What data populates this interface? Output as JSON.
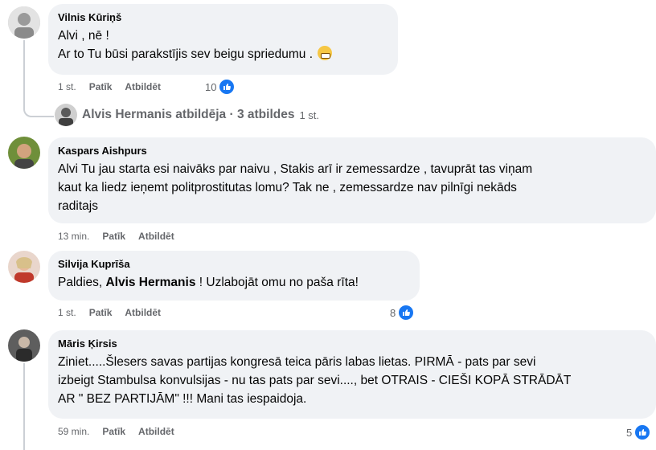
{
  "comments": [
    {
      "author": "Vilnis Kūriņš",
      "lines": [
        "Alvi , nē !",
        "Ar to Tu būsi parakstījis sev beigu spriedumu ."
      ],
      "emoji": "grimacing-emoji",
      "time": "1 st.",
      "like": "Patīk",
      "reply": "Atbildēt",
      "reactions": "10",
      "avatar_color": "#b9b9b9"
    },
    {
      "author": "Kaspars Aishpurs",
      "lines": [
        "Alvi Tu jau starta esi naivāks par naivu , Stakis arī ir zemessardze , tavuprāt tas viņam",
        "kaut ka liedz ieņemt politprostitutas lomu? Tak ne , zemessardze nav pilnīgi nekāds",
        "raditajs"
      ],
      "time": "13 min.",
      "like": "Patīk",
      "reply": "Atbildēt",
      "avatar_color": "#6f8f3a"
    },
    {
      "author": "Silvija Kuprīša",
      "line_prefix": "Paldies, ",
      "mention": "Alvis Hermanis",
      "line_suffix": " ! Uzlabojāt omu no paša rīta!",
      "time": "1 st.",
      "like": "Patīk",
      "reply": "Atbildēt",
      "reactions": "8",
      "avatar_color": "#d9a79a"
    },
    {
      "author": "Māris Ķirsis",
      "lines": [
        "Ziniet.....Šlesers savas partijas kongresā teica pāris labas lietas. PIRMĀ - pats par sevi",
        "izbeigt Stambulsa konvulsijas - nu tas pats par sevi...., bet OTRAIS - CIEŠI KOPĀ STRĀDĀT",
        "AR \" BEZ PARTIJĀM\" !!! Mani tas iespaidoja."
      ],
      "time": "59 min.",
      "like": "Patīk",
      "reply": "Atbildēt",
      "reactions": "5",
      "avatar_color": "#7a7a7a"
    }
  ],
  "reply_thread": {
    "name": "Alvis Hermanis atbildēja",
    "sep": " · ",
    "count": "3 atbildes",
    "time": "1 st."
  },
  "colors": {
    "like_blue": "#1877f2",
    "bubble": "#f0f2f5",
    "meta": "#65676b"
  }
}
